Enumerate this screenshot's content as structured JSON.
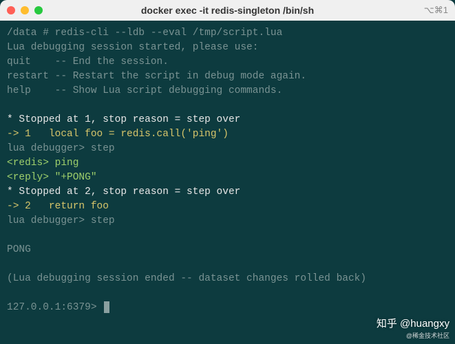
{
  "titlebar": {
    "title": "docker exec -it redis-singleton /bin/sh",
    "shortcut": "⌥⌘1"
  },
  "terminal": {
    "lines": [
      {
        "cls": "muted",
        "text": "/data # redis-cli --ldb --eval /tmp/script.lua"
      },
      {
        "cls": "muted",
        "text": "Lua debugging session started, please use:"
      },
      {
        "cls": "muted",
        "text": "quit    -- End the session."
      },
      {
        "cls": "muted",
        "text": "restart -- Restart the script in debug mode again."
      },
      {
        "cls": "muted",
        "text": "help    -- Show Lua script debugging commands."
      },
      {
        "cls": "muted",
        "text": " "
      },
      {
        "cls": "white",
        "text": "* Stopped at 1, stop reason = step over"
      },
      {
        "cls": "yellow",
        "text": "-> 1   local foo = redis.call('ping')"
      },
      {
        "cls": "muted",
        "text": "lua debugger> step"
      },
      {
        "cls": "green",
        "text": "<redis> ping"
      },
      {
        "cls": "green",
        "text": "<reply> \"+PONG\""
      },
      {
        "cls": "white",
        "text": "* Stopped at 2, stop reason = step over"
      },
      {
        "cls": "yellow",
        "text": "-> 2   return foo"
      },
      {
        "cls": "muted",
        "text": "lua debugger> step"
      },
      {
        "cls": "muted",
        "text": " "
      },
      {
        "cls": "muted",
        "text": "PONG"
      },
      {
        "cls": "muted",
        "text": " "
      },
      {
        "cls": "muted",
        "text": "(Lua debugging session ended -- dataset changes rolled back)"
      },
      {
        "cls": "muted",
        "text": " "
      },
      {
        "cls": "muted",
        "text": "127.0.0.1:6379> ",
        "cursor": true
      }
    ]
  },
  "watermark": {
    "brand": "知乎",
    "handle": "@huangxy",
    "subtitle": "@稀金技术社区"
  }
}
